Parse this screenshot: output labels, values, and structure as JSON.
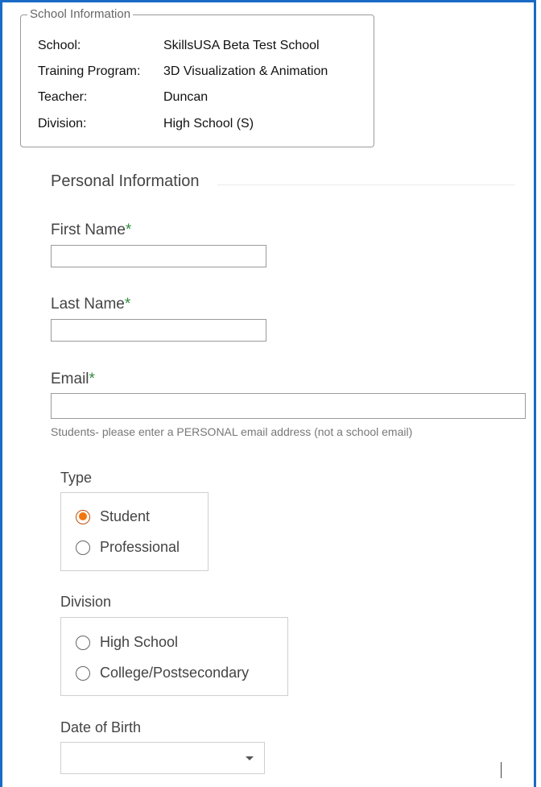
{
  "school_info": {
    "legend": "School Information",
    "rows": [
      {
        "label": "School:",
        "value": "SkillsUSA Beta Test School"
      },
      {
        "label": "Training Program:",
        "value": "3D Visualization & Animation"
      },
      {
        "label": "Teacher:",
        "value": "Duncan"
      },
      {
        "label": "Division:",
        "value": "High School (S)"
      }
    ]
  },
  "personal": {
    "title": "Personal Information",
    "first_name": {
      "label": "First Name",
      "required_mark": "*",
      "value": ""
    },
    "last_name": {
      "label": "Last Name",
      "required_mark": "*",
      "value": ""
    },
    "email": {
      "label": "Email",
      "required_mark": "*",
      "value": "",
      "hint": "Students- please enter a PERSONAL email address (not a school email)"
    }
  },
  "type": {
    "label": "Type",
    "options": [
      {
        "label": "Student",
        "checked": true
      },
      {
        "label": "Professional",
        "checked": false
      }
    ]
  },
  "division": {
    "label": "Division",
    "options": [
      {
        "label": "High School",
        "checked": false
      },
      {
        "label": "College/Postsecondary",
        "checked": false
      }
    ]
  },
  "dob": {
    "label": "Date of Birth",
    "value": ""
  },
  "colors": {
    "accent": "#f2760f",
    "frame": "#1a6ac6",
    "required": "#2f8a3b"
  },
  "icons": {
    "dropdown": "chevron-down-icon"
  }
}
